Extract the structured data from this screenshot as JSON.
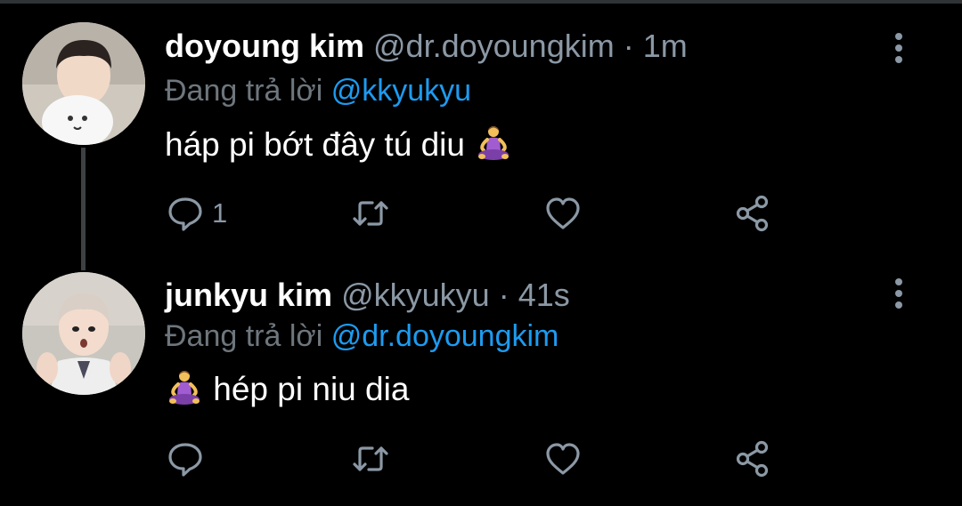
{
  "tweets": [
    {
      "display_name": "doyoung kim",
      "handle": "@dr.doyoungkim",
      "separator": "·",
      "time": "1m",
      "replying_prefix": "Đang trả lời",
      "replying_to": "@kkyukyu",
      "text": "háp pi bớt đây tú diu",
      "text_emoji": "person-in-lotus-position",
      "reply_count": "1",
      "retweet_count": "",
      "like_count": ""
    },
    {
      "display_name": "junkyu kim",
      "handle": "@kkyukyu",
      "separator": "·",
      "time": "41s",
      "replying_prefix": "Đang trả lời",
      "replying_to": "@dr.doyoungkim",
      "text": "hép pi niu dia",
      "text_emoji": "person-in-lotus-position",
      "reply_count": "",
      "retweet_count": "",
      "like_count": ""
    }
  ],
  "icons": {
    "reply": "reply-icon",
    "retweet": "retweet-icon",
    "like": "heart-icon",
    "share": "share-icon",
    "more": "more-vertical-icon"
  },
  "colors": {
    "background": "#000000",
    "text": "#ffffff",
    "meta": "#8b98a5",
    "mention": "#1d9bf0",
    "thread_line": "#3d4144"
  }
}
